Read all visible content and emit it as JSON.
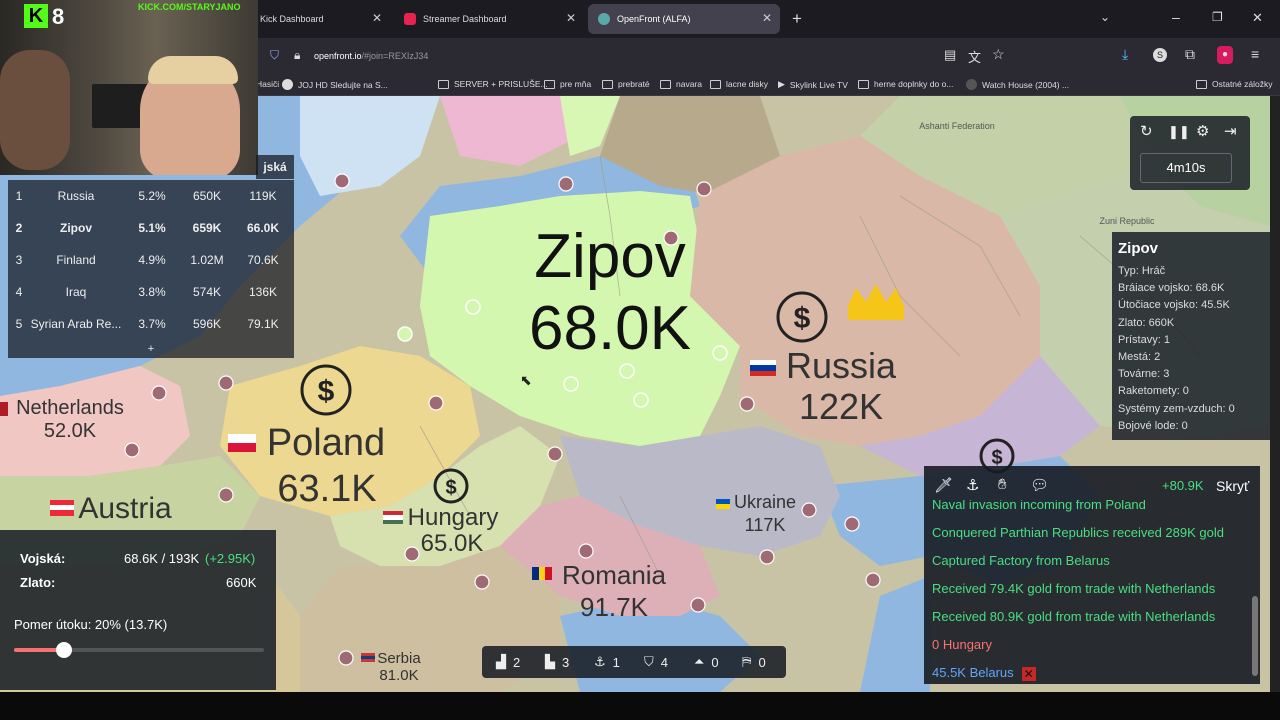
{
  "browser": {
    "tabs": [
      {
        "label": "Kick Dashboard",
        "active": false
      },
      {
        "label": "Streamer Dashboard",
        "active": false
      },
      {
        "label": "OpenFront (ALFA)",
        "active": true
      }
    ],
    "url_host": "openfront.io",
    "url_rest": "/#join=REXIzJ34",
    "bookmarks": [
      "Hasiči",
      "JOJ HD Sledujte na S...",
      "SERVER + PRISLUŠE...",
      "pre mňa",
      "prebraté",
      "navara",
      "lacne disky",
      "Skylink Live TV",
      "herne doplnky do o...",
      "Watch House (2004) ...",
      "Ostatné záložky"
    ]
  },
  "webcam": {
    "brand_badge": "8",
    "channel": "KICK.COM/STARYJANO"
  },
  "leaderboard": {
    "header_fragment": "jská",
    "rows": [
      {
        "rank": "1",
        "name": "Russia",
        "pct": "5.2%",
        "gold": "650K",
        "troops": "119K"
      },
      {
        "rank": "2",
        "name": "Zipov",
        "pct": "5.1%",
        "gold": "659K",
        "troops": "66.0K"
      },
      {
        "rank": "3",
        "name": "Finland",
        "pct": "4.9%",
        "gold": "1.02M",
        "troops": "70.6K"
      },
      {
        "rank": "4",
        "name": "Iraq",
        "pct": "3.8%",
        "gold": "574K",
        "troops": "136K"
      },
      {
        "rank": "5",
        "name": "Syrian Arab Re...",
        "pct": "3.7%",
        "gold": "596K",
        "troops": "79.1K"
      }
    ],
    "expand_label": "+"
  },
  "map_labels": {
    "zipov_name": "Zipov",
    "zipov_troops": "68.0K",
    "russia_name": "Russia",
    "russia_troops": "122K",
    "poland_name": "Poland",
    "poland_troops": "63.1K",
    "netherlands_name": "Netherlands",
    "netherlands_troops": "52.0K",
    "austria_name": "Austria",
    "hungary_name": "Hungary",
    "hungary_troops": "65.0K",
    "ukraine_name": "Ukraine",
    "ukraine_troops": "117K",
    "romania_name": "Romania",
    "romania_troops": "91.7K",
    "serbia_name": "Serbia",
    "serbia_troops": "81.0K",
    "ashanti": "Ashanti Federation",
    "zuni": "Zuni Republic"
  },
  "controls": {
    "timer": "4m10s"
  },
  "player_info": {
    "name": "Zipov",
    "lines": [
      "Typ: Hráč",
      "Bráiace vojsko: 68.6K",
      "Útočiace vojsko: 45.5K",
      "Zlato: 660K",
      "Prístavy: 1",
      "Mestá: 2",
      "Továrne: 3",
      "Raketomety: 0",
      "Systémy zem-vzduch: 0",
      "Bojové lode: 0"
    ]
  },
  "stats": {
    "troops_label": "Vojská:",
    "troops_value": "68.6K / 193K",
    "troops_delta": "(+2.95K)",
    "gold_label": "Zlato:",
    "gold_value": "660K",
    "attack_ratio_label": "Pomer útoku: 20% (13.7K)",
    "attack_ratio": 0.2
  },
  "events": {
    "gold_rate": "+80.9K",
    "hide_label": "Skryť",
    "messages": [
      "Naval invasion incoming from Poland",
      "Conquered Parthian Republics received 289K gold",
      "Captured Factory from Belarus",
      "Received 79.4K gold from trade with Netherlands",
      "Received 80.9K gold from trade with Netherlands",
      "0 Hungary",
      "45.5K Belarus"
    ]
  },
  "bottom_bar": {
    "cities": "2",
    "factories": "3",
    "ports": "1",
    "defense": "4",
    "missiles": "0",
    "sams": "0"
  },
  "colors": {
    "player": "#d4f7b0",
    "accent_green": "#4ade80",
    "event_red": "#f87171",
    "link_blue": "#60a5fa"
  }
}
